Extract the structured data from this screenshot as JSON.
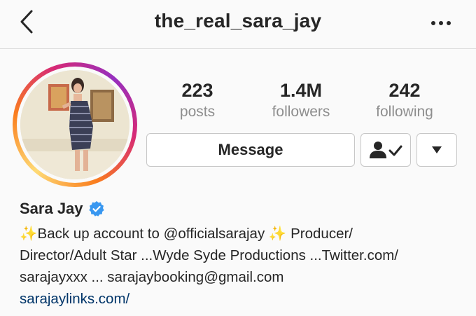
{
  "header": {
    "username": "the_real_sara_jay",
    "back_icon": "chevron-left-icon",
    "more_icon": "more-dots-icon"
  },
  "profile": {
    "avatar_alt": "profile picture",
    "stats": [
      {
        "value": "223",
        "label": "posts"
      },
      {
        "value": "1.4M",
        "label": "followers"
      },
      {
        "value": "242",
        "label": "following"
      }
    ],
    "buttons": {
      "message_label": "Message",
      "following_icon": "person-check-icon",
      "dropdown_icon": "caret-down-icon"
    },
    "name": "Sara Jay",
    "verified_icon": "verified-badge-icon",
    "bio_lines": [
      "✨Back up account to @officialsarajay ✨ Producer/",
      "Director/Adult Star ...Wyde Syde Productions ...Twitter.com/",
      "sarajayxxx ... sarajaybooking@gmail.com"
    ],
    "link": "sarajaylinks.com/"
  },
  "colors": {
    "accent_link": "#003569",
    "verified_blue": "#3897f0",
    "muted_text": "#8e8e8e",
    "border": "#dbdbdb"
  }
}
